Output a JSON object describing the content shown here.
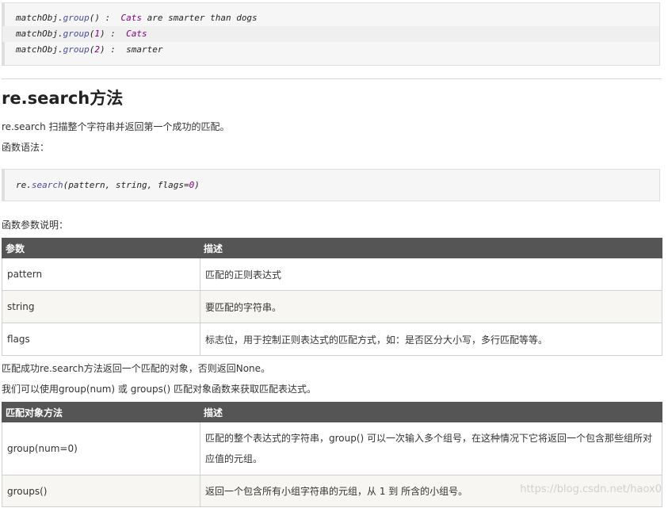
{
  "top_code": {
    "lines": [
      {
        "obj": "matchObj",
        "method": "group",
        "args": "()",
        "num": "",
        "sep": " :  ",
        "str": "Cats",
        "rest": " are smarter than dogs"
      },
      {
        "obj": "matchObj",
        "method": "group",
        "args": "(",
        "num": "1",
        "sep": ") :  ",
        "str": "Cats",
        "rest": ""
      },
      {
        "obj": "matchObj",
        "method": "group",
        "args": "(",
        "num": "2",
        "sep": ") :  ",
        "str": "",
        "rest": "smarter"
      }
    ]
  },
  "section": {
    "title": "re.search方法",
    "desc": "re.search 扫描整个字符串并返回第一个成功的匹配。",
    "syntax_label": "函数语法：",
    "syntax_code": {
      "fn": "re",
      "method": "search",
      "open": "(",
      "p1": "pattern",
      "c1": ", ",
      "p2": "string",
      "c2": ", ",
      "p3": "flags",
      "eq": "=",
      "num": "0",
      "close": ")"
    },
    "params_label": "函数参数说明："
  },
  "params_table": {
    "headers": [
      "参数",
      "描述"
    ],
    "rows": [
      [
        "pattern",
        "匹配的正则表达式"
      ],
      [
        "string",
        "要匹配的字符串。"
      ],
      [
        "flags",
        "标志位，用于控制正则表达式的匹配方式，如：是否区分大小写，多行匹配等等。"
      ]
    ]
  },
  "after_text": {
    "line1": "匹配成功re.search方法返回一个匹配的对象，否则返回None。",
    "line2": "我们可以使用group(num) 或 groups() 匹配对象函数来获取匹配表达式。"
  },
  "methods_table": {
    "headers": [
      "匹配对象方法",
      "描述"
    ],
    "rows": [
      [
        "group(num=0)",
        "匹配的整个表达式的字符串，group() 可以一次输入多个组号，在这种情况下它将返回一个包含那些组所对应值的元组。"
      ],
      [
        "groups()",
        "返回一个包含所有小组字符串的元组，从 1 到 所含的小组号。"
      ]
    ]
  },
  "watermark": "https://blog.csdn.net/haox0"
}
